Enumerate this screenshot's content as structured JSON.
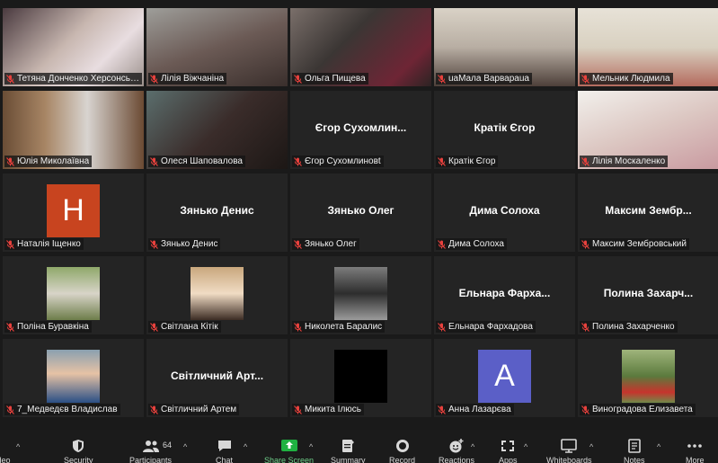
{
  "colors": {
    "active_outline": "#c9dc4a",
    "share_green": "#1fb141",
    "mic_red": "#e8413d"
  },
  "tiles": [
    {
      "name": "Тетяна Донченко  Херсонська ...",
      "type": "video",
      "active": true
    },
    {
      "name": "Лілія Віжчаніна",
      "type": "video"
    },
    {
      "name": "Ольга Пищева",
      "type": "video"
    },
    {
      "name": "uaMaла Варвараua",
      "type": "video"
    },
    {
      "name": "Мельник Людмила",
      "type": "video"
    },
    {
      "name": "Юлія Миколаївна",
      "type": "video"
    },
    {
      "name": "Олеся Шаповалова",
      "type": "video"
    },
    {
      "name": "Єгор Сухомлиновt",
      "type": "name",
      "display": "Єгор  Сухомлин..."
    },
    {
      "name": "Кратік Єгор",
      "type": "name",
      "display": "Кратік Єгор"
    },
    {
      "name": "Лілія Москаленко",
      "type": "video"
    },
    {
      "name": "Наталія Іщенко",
      "type": "letter",
      "letter": "H",
      "letter_color": "#c8441f"
    },
    {
      "name": "Зянько Денис",
      "type": "name",
      "display": "Зянько Денис"
    },
    {
      "name": "Зянько Олег",
      "type": "name",
      "display": "Зянько Олег"
    },
    {
      "name": "Дима Солоха",
      "type": "name",
      "display": "Дима Солоха"
    },
    {
      "name": "Максим Зембровський",
      "type": "name",
      "display": "Максим  Зембр..."
    },
    {
      "name": "Поліна Буравкіна",
      "type": "photo"
    },
    {
      "name": "Світлана Кітік",
      "type": "photo"
    },
    {
      "name": "Николета Баралис",
      "type": "photo"
    },
    {
      "name": "Ельнара Фархадова",
      "type": "name",
      "display": "Ельнара  Фарха..."
    },
    {
      "name": "Полина Захарченко",
      "type": "name",
      "display": "Полина  Захарч..."
    },
    {
      "name": "7_Медведєв Владислав",
      "type": "photo"
    },
    {
      "name": "Світличний Артем",
      "type": "name",
      "display": "Світличний  Арт..."
    },
    {
      "name": "Микита Ілюсь",
      "type": "black"
    },
    {
      "name": "Анна Лазарєва",
      "type": "letter",
      "letter": "A",
      "letter_color": "#5b5fc7"
    },
    {
      "name": "Виноградова Елизавета",
      "type": "photo"
    }
  ],
  "toolbar": {
    "video": "ideo",
    "security": "Security",
    "participants": "Participants",
    "participants_count": "64",
    "chat": "Chat",
    "share": "Share Screen",
    "summary": "Summary",
    "record": "Record",
    "reactions": "Reactions",
    "apps": "Apps",
    "whiteboards": "Whiteboards",
    "notes": "Notes",
    "more": "More"
  }
}
